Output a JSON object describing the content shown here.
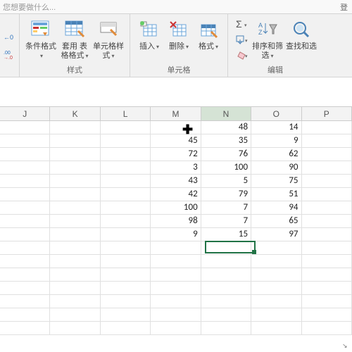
{
  "tellme": {
    "placeholder": "您想要做什么...",
    "right": "登"
  },
  "ribbon": {
    "numfmt": {
      "inc": "←0",
      "dec": ".00"
    },
    "styles": {
      "cond": "条件格式",
      "table": "套用\n表格格式",
      "cell": "单元格样式",
      "group": "样式"
    },
    "cells": {
      "insert": "插入",
      "delete": "删除",
      "format": "格式",
      "group": "单元格"
    },
    "editing": {
      "sort": "排序和筛选",
      "find": "查找和选",
      "group": "编辑"
    }
  },
  "columns": [
    "J",
    "K",
    "L",
    "M",
    "N",
    "O",
    "P"
  ],
  "gridData": [
    [
      "",
      "",
      "",
      "",
      "48",
      "14",
      ""
    ],
    [
      "",
      "",
      "",
      "45",
      "35",
      "9",
      ""
    ],
    [
      "",
      "",
      "",
      "72",
      "76",
      "62",
      ""
    ],
    [
      "",
      "",
      "",
      "3",
      "100",
      "90",
      ""
    ],
    [
      "",
      "",
      "",
      "43",
      "5",
      "75",
      ""
    ],
    [
      "",
      "",
      "",
      "42",
      "79",
      "51",
      ""
    ],
    [
      "",
      "",
      "",
      "100",
      "7",
      "94",
      ""
    ],
    [
      "",
      "",
      "",
      "98",
      "7",
      "65",
      ""
    ],
    [
      "",
      "",
      "",
      "9",
      "15",
      "97",
      ""
    ],
    [
      "",
      "",
      "",
      "",
      "",
      "",
      ""
    ],
    [
      "",
      "",
      "",
      "",
      "",
      "",
      ""
    ],
    [
      "",
      "",
      "",
      "",
      "",
      "",
      ""
    ],
    [
      "",
      "",
      "",
      "",
      "",
      "",
      ""
    ],
    [
      "",
      "",
      "",
      "",
      "",
      "",
      ""
    ],
    [
      "",
      "",
      "",
      "",
      "",
      "",
      ""
    ],
    [
      "",
      "",
      "",
      "",
      "",
      "",
      ""
    ]
  ],
  "activeCell": {
    "col": 4,
    "row": 9
  }
}
